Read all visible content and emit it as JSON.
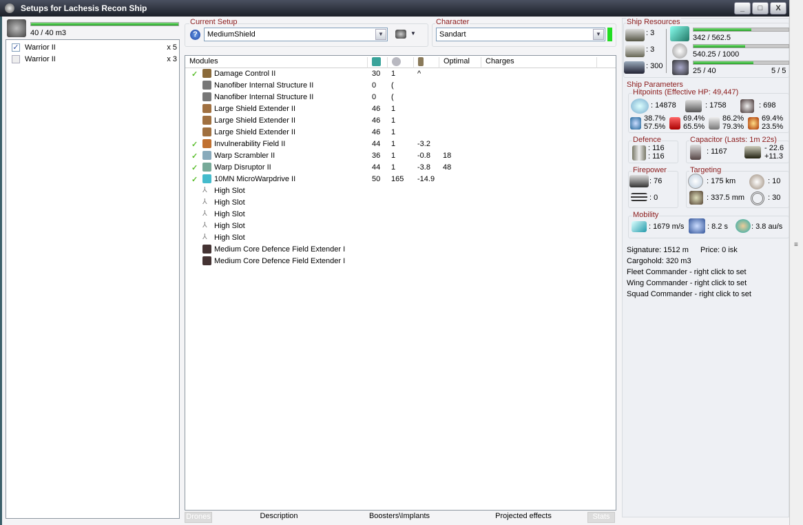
{
  "window": {
    "title": "Setups for Lachesis Recon Ship",
    "buttons": [
      "_",
      "□",
      "X"
    ]
  },
  "drones": {
    "bandwidth": "40 / 40 m3",
    "bandwidth_fraction": 1.0,
    "items": [
      {
        "name": "Warrior II",
        "count": "x 5",
        "checked": true
      },
      {
        "name": "Warrior II",
        "count": "x 3",
        "checked": false
      }
    ]
  },
  "setup": {
    "label": "Current Setup",
    "value": "MediumShield",
    "help_icon": "question-icon",
    "drone_menu_icon": "drone-icon"
  },
  "character": {
    "label": "Character",
    "value": "Sandart",
    "status_color": "#22dd22"
  },
  "modules": {
    "columns": [
      "Modules",
      "cpu-icon",
      "powergrid-icon",
      "capacitor-icon",
      "Optimal",
      "Charges"
    ],
    "rows": [
      {
        "active": true,
        "name": "Damage Control II",
        "cpu": "30",
        "pg": "1",
        "cap": "^",
        "optimal": "",
        "icon": "damage-control-icon"
      },
      {
        "active": false,
        "name": "Nanofiber Internal Structure II",
        "cpu": "0",
        "pg": "(",
        "cap": "",
        "optimal": "",
        "icon": "nanofiber-icon"
      },
      {
        "active": false,
        "name": "Nanofiber Internal Structure II",
        "cpu": "0",
        "pg": "(",
        "cap": "",
        "optimal": "",
        "icon": "nanofiber-icon"
      },
      {
        "active": false,
        "name": "Large Shield Extender II",
        "cpu": "46",
        "pg": "1",
        "cap": "",
        "optimal": "",
        "icon": "shield-extender-icon"
      },
      {
        "active": false,
        "name": "Large Shield Extender II",
        "cpu": "46",
        "pg": "1",
        "cap": "",
        "optimal": "",
        "icon": "shield-extender-icon"
      },
      {
        "active": false,
        "name": "Large Shield Extender II",
        "cpu": "46",
        "pg": "1",
        "cap": "",
        "optimal": "",
        "icon": "shield-extender-icon"
      },
      {
        "active": true,
        "name": "Invulnerability Field II",
        "cpu": "44",
        "pg": "1",
        "cap": "-3.2",
        "optimal": "",
        "icon": "invulnerability-icon"
      },
      {
        "active": true,
        "name": "Warp Scrambler II",
        "cpu": "36",
        "pg": "1",
        "cap": "-0.8",
        "optimal": "18",
        "icon": "warp-scrambler-icon"
      },
      {
        "active": true,
        "name": "Warp Disruptor II",
        "cpu": "44",
        "pg": "1",
        "cap": "-3.8",
        "optimal": "48",
        "icon": "warp-disruptor-icon"
      },
      {
        "active": true,
        "name": "10MN MicroWarpdrive II",
        "cpu": "50",
        "pg": "165",
        "cap": "-14.9",
        "optimal": "",
        "icon": "mwd-icon"
      },
      {
        "active": false,
        "name": "High Slot",
        "cpu": "",
        "pg": "",
        "cap": "",
        "optimal": "",
        "icon": "slot-icon"
      },
      {
        "active": false,
        "name": "High Slot",
        "cpu": "",
        "pg": "",
        "cap": "",
        "optimal": "",
        "icon": "slot-icon"
      },
      {
        "active": false,
        "name": "High Slot",
        "cpu": "",
        "pg": "",
        "cap": "",
        "optimal": "",
        "icon": "slot-icon"
      },
      {
        "active": false,
        "name": "High Slot",
        "cpu": "",
        "pg": "",
        "cap": "",
        "optimal": "",
        "icon": "slot-icon"
      },
      {
        "active": false,
        "name": "High Slot",
        "cpu": "",
        "pg": "",
        "cap": "",
        "optimal": "",
        "icon": "slot-icon"
      },
      {
        "active": false,
        "name": "Medium Core Defence Field Extender I",
        "cpu": "",
        "pg": "",
        "cap": "",
        "optimal": "",
        "icon": "rig-icon"
      },
      {
        "active": false,
        "name": "Medium Core Defence Field Extender I",
        "cpu": "",
        "pg": "",
        "cap": "",
        "optimal": "",
        "icon": "rig-icon"
      }
    ]
  },
  "tabs": [
    "Drones",
    "Description",
    "Boosters\\Implants",
    "Projected effects",
    "Stats"
  ],
  "resources": {
    "label": "Ship Resources",
    "turrets": ": 3",
    "launchers": ": 3",
    "calibration": ": 300",
    "cpu": "342 / 562.5",
    "cpu_fraction": 0.61,
    "powergrid": "540.25 / 1000",
    "pg_fraction": 0.54,
    "drone_bay": "25 / 40",
    "drone_fraction": 0.63,
    "drones_active": "5 / 5"
  },
  "params": {
    "label": "Ship Parameters",
    "hp_label": "Hitpoints (Effective HP: 49,447)",
    "shield": ": 14878",
    "armor": ": 1758",
    "structure": ": 698",
    "resists": [
      {
        "icon": "em-icon",
        "a": "38.7%",
        "b": "57.5%"
      },
      {
        "icon": "thermal-icon",
        "a": "69.4%",
        "b": "65.5%"
      },
      {
        "icon": "kinetic-icon",
        "a": "86.2%",
        "b": "79.3%"
      },
      {
        "icon": "explosive-icon",
        "a": "69.4%",
        "b": "23.5%"
      }
    ],
    "defence_label": "Defence",
    "defence_a": ": 116",
    "defence_b": ": 116",
    "cap_label": "Capacitor (Lasts: 1m 22s)",
    "cap_value": ": 1167",
    "cap_use": "- 22.6",
    "cap_regen": "+11.3",
    "fire_label": "Firepower",
    "fire_turret": ": 76",
    "fire_missile": ": 0",
    "target_label": "Targeting",
    "range": ": 175 km",
    "targets": ": 10",
    "sensor": ": 337.5 mm",
    "scan": ": 30",
    "mob_label": "Mobility",
    "speed": ": 1679 m/s",
    "align": ": 8.2 s",
    "warp": ": 3.8 au/s"
  },
  "info": {
    "signature": "Signature: 1512 m",
    "price": "Price: 0 isk",
    "cargo": "Cargohold: 320 m3",
    "fleet": "Fleet Commander - right click to set",
    "wing": "Wing Commander - right click to set",
    "squad": "Squad Commander - right click to set"
  }
}
